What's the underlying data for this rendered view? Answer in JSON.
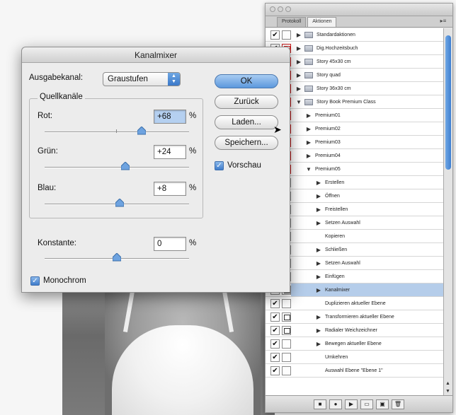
{
  "dialog": {
    "title": "Kanalmixer",
    "output_channel_label": "Ausgabekanal:",
    "output_channel_value": "Graustufen",
    "source_group_title": "Quellkanäle",
    "channels": [
      {
        "label": "Rot:",
        "value": "+68",
        "unit": "%",
        "slider_percent": 68
      },
      {
        "label": "Grün:",
        "value": "+24",
        "unit": "%",
        "slider_percent": 24
      },
      {
        "label": "Blau:",
        "value": "+8",
        "unit": "%",
        "slider_percent": 8
      }
    ],
    "constant": {
      "label": "Konstante:",
      "value": "0",
      "unit": "%",
      "slider_percent": 0
    },
    "monochrome_label": "Monochrom",
    "monochrome_checked": true,
    "buttons": {
      "ok": "OK",
      "reset": "Zurück",
      "load": "Laden...",
      "save": "Speichern..."
    },
    "preview_label": "Vorschau",
    "preview_checked": true
  },
  "actions_panel": {
    "tabs": [
      "Protokoll",
      "Aktionen"
    ],
    "active_tab": "Aktionen",
    "rows": [
      {
        "label": "Standardaktionen",
        "indent": 0,
        "expanded": false,
        "folder": true,
        "check": "✔",
        "dialog": ""
      },
      {
        "label": "Dig.Hochzeitsbuch",
        "indent": 0,
        "expanded": false,
        "folder": true,
        "check": "✔",
        "dialog": "red"
      },
      {
        "label": "Story 45x30 cm",
        "indent": 0,
        "expanded": false,
        "folder": true,
        "check": "✔",
        "dialog": "red"
      },
      {
        "label": "Story quad",
        "indent": 0,
        "expanded": false,
        "folder": true,
        "check": "✔",
        "dialog": "red"
      },
      {
        "label": "Story 36x30 cm",
        "indent": 0,
        "expanded": false,
        "folder": true,
        "check": "✔",
        "dialog": "red"
      },
      {
        "label": "Story Book Premium Class",
        "indent": 0,
        "expanded": true,
        "folder": true,
        "check": "✔",
        "dialog": "red"
      },
      {
        "label": "Premium01",
        "indent": 1,
        "expanded": false,
        "folder": false,
        "check": "✔",
        "dialog": "red"
      },
      {
        "label": "Premium02",
        "indent": 1,
        "expanded": false,
        "folder": false,
        "check": "✔",
        "dialog": "red"
      },
      {
        "label": "Premium03",
        "indent": 1,
        "expanded": false,
        "folder": false,
        "check": "✔",
        "dialog": "red"
      },
      {
        "label": "Premium04",
        "indent": 1,
        "expanded": false,
        "folder": false,
        "check": "✔",
        "dialog": "red"
      },
      {
        "label": "Premium05",
        "indent": 1,
        "expanded": true,
        "folder": false,
        "check": "✔",
        "dialog": "red"
      },
      {
        "label": "Erstellen",
        "indent": 2,
        "expanded": false,
        "folder": false,
        "check": "✔",
        "dialog": ""
      },
      {
        "label": "Öffnen",
        "indent": 2,
        "expanded": false,
        "folder": false,
        "check": "✔",
        "dialog": "black"
      },
      {
        "label": "Freistellen",
        "indent": 2,
        "expanded": false,
        "folder": false,
        "check": "✔",
        "dialog": "black"
      },
      {
        "label": "Setzen Auswahl",
        "indent": 2,
        "expanded": false,
        "folder": false,
        "check": "✔",
        "dialog": ""
      },
      {
        "label": "Kopieren",
        "indent": 2,
        "expanded": null,
        "folder": false,
        "check": "✔",
        "dialog": ""
      },
      {
        "label": "Schließen",
        "indent": 2,
        "expanded": false,
        "folder": false,
        "check": "✔",
        "dialog": ""
      },
      {
        "label": "Setzen Auswahl",
        "indent": 2,
        "expanded": false,
        "folder": false,
        "check": "✔",
        "dialog": ""
      },
      {
        "label": "Einfügen",
        "indent": 2,
        "expanded": false,
        "folder": false,
        "check": "✔",
        "dialog": ""
      },
      {
        "label": "Kanalmixer",
        "indent": 2,
        "expanded": false,
        "folder": false,
        "check": "✔",
        "dialog": "black",
        "selected": true
      },
      {
        "label": "Duplizieren aktueller Ebene",
        "indent": 2,
        "expanded": null,
        "folder": false,
        "check": "✔",
        "dialog": ""
      },
      {
        "label": "Transformieren aktueller Ebene",
        "indent": 2,
        "expanded": false,
        "folder": false,
        "check": "✔",
        "dialog": "black"
      },
      {
        "label": "Radialer Weichzeichner",
        "indent": 2,
        "expanded": false,
        "folder": false,
        "check": "✔",
        "dialog": "black"
      },
      {
        "label": "Bewegen aktueller Ebene",
        "indent": 2,
        "expanded": false,
        "folder": false,
        "check": "✔",
        "dialog": ""
      },
      {
        "label": "Umkehren",
        "indent": 2,
        "expanded": null,
        "folder": false,
        "check": "✔",
        "dialog": ""
      },
      {
        "label": "Auswahl Ebene \"Ebene 1\"",
        "indent": 2,
        "expanded": null,
        "folder": false,
        "check": "✔",
        "dialog": ""
      }
    ],
    "bottom_buttons": [
      "■",
      "●",
      "▶",
      "▭",
      "▣",
      "🗑"
    ]
  }
}
